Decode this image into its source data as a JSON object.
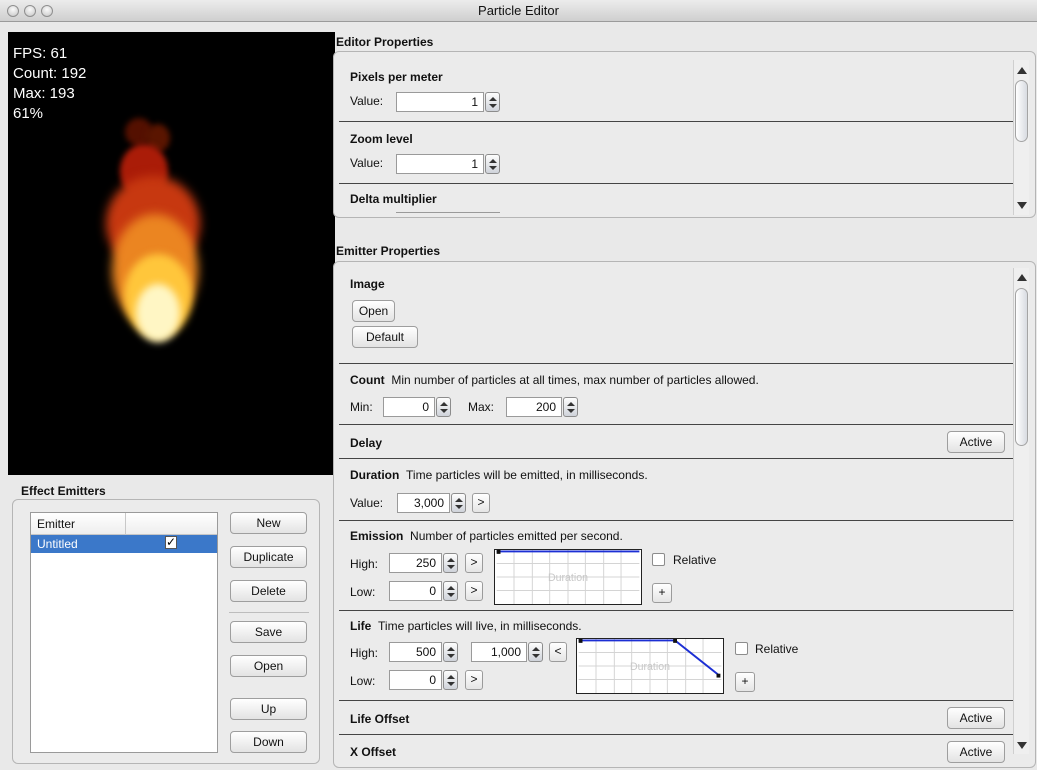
{
  "window": {
    "title": "Particle Editor"
  },
  "stats": {
    "fps": "FPS: 61",
    "count": "Count: 192",
    "max": "Max: 193",
    "percent": "61%"
  },
  "editor_properties": {
    "title": "Editor Properties",
    "pixels_per_meter": {
      "label": "Pixels per meter",
      "value_label": "Value:",
      "value": "1"
    },
    "zoom_level": {
      "label": "Zoom level",
      "value_label": "Value:",
      "value": "1"
    },
    "delta_multiplier": {
      "label": "Delta multiplier"
    }
  },
  "emitter_properties": {
    "title": "Emitter Properties",
    "image": {
      "label": "Image",
      "open": "Open",
      "default": "Default"
    },
    "count": {
      "label": "Count",
      "description": "Min number of particles at all times, max number of particles allowed.",
      "min_label": "Min:",
      "min": "0",
      "max_label": "Max:",
      "max": "200"
    },
    "delay": {
      "label": "Delay",
      "active": "Active"
    },
    "duration": {
      "label": "Duration",
      "description": "Time particles will be emitted, in milliseconds.",
      "value_label": "Value:",
      "value": "3,000",
      "expand": ">"
    },
    "emission": {
      "label": "Emission",
      "description": "Number of particles emitted per second.",
      "high_label": "High:",
      "high": "250",
      "low_label": "Low:",
      "low": "0",
      "expand": ">",
      "graph_label": "Duration",
      "relative": "Relative",
      "add": "+"
    },
    "life": {
      "label": "Life",
      "description": "Time particles will live, in milliseconds.",
      "high_label": "High:",
      "high": "500",
      "high2": "1,000",
      "collapse": "<",
      "low_label": "Low:",
      "low": "0",
      "expand": ">",
      "graph_label": "Duration",
      "relative": "Relative",
      "add": "+"
    },
    "life_offset": {
      "label": "Life Offset",
      "active": "Active"
    },
    "x_offset": {
      "label": "X Offset",
      "active": "Active"
    }
  },
  "effect_emitters": {
    "title": "Effect Emitters",
    "columns": [
      "Emitter",
      ""
    ],
    "rows": [
      {
        "name": "Untitled",
        "checked": true
      }
    ],
    "buttons": {
      "new": "New",
      "duplicate": "Duplicate",
      "delete": "Delete",
      "save": "Save",
      "open": "Open",
      "up": "Up",
      "down": "Down"
    }
  },
  "colors": {
    "selection": "#3b78c9",
    "graph_line": "#1c2fd4",
    "preview_bg": "#000000"
  }
}
